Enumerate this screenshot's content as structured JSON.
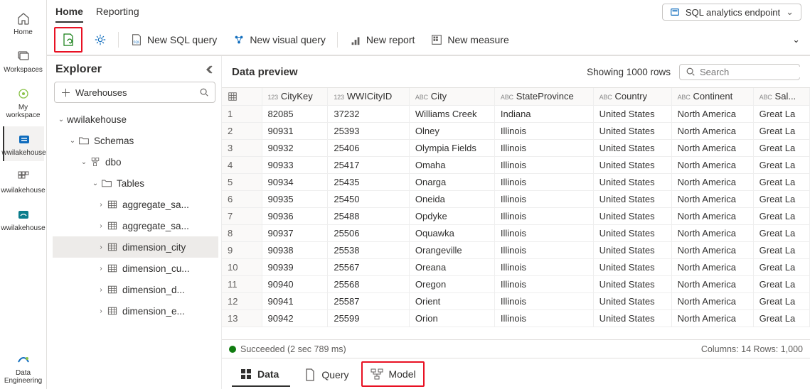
{
  "rail": {
    "items": [
      {
        "label": "Home",
        "icon": "home"
      },
      {
        "label": "Workspaces",
        "icon": "stack"
      },
      {
        "label": "My workspace",
        "icon": "sparkle"
      },
      {
        "label": "wwilakehouse",
        "icon": "lakehouse-blue",
        "active": true
      },
      {
        "label": "wwilakehouse",
        "icon": "grid9"
      },
      {
        "label": "wwilakehouse",
        "icon": "lakehouse-teal"
      }
    ],
    "footer": {
      "label": "Data Engineering",
      "icon": "swoosh"
    }
  },
  "topnav": {
    "items": [
      "Home",
      "Reporting"
    ],
    "active": "Home"
  },
  "endpoint": {
    "label": "SQL analytics endpoint"
  },
  "toolbar": {
    "refresh": "",
    "settings": "",
    "new_sql": "New SQL query",
    "new_visual": "New visual query",
    "new_report": "New report",
    "new_measure": "New measure"
  },
  "explorer": {
    "title": "Explorer",
    "warehouses_label": "Warehouses",
    "root": "wwilakehouse",
    "schemas_label": "Schemas",
    "dbo_label": "dbo",
    "tables_label": "Tables",
    "tables": [
      {
        "name": "aggregate_sa..."
      },
      {
        "name": "aggregate_sa..."
      },
      {
        "name": "dimension_city",
        "selected": true
      },
      {
        "name": "dimension_cu..."
      },
      {
        "name": "dimension_d..."
      },
      {
        "name": "dimension_e..."
      }
    ]
  },
  "preview": {
    "title": "Data preview",
    "showing_label": "Showing 1000 rows",
    "search_placeholder": "Search",
    "columns": [
      {
        "type": "123",
        "name": "CityKey"
      },
      {
        "type": "123",
        "name": "WWICityID"
      },
      {
        "type": "ABC",
        "name": "City"
      },
      {
        "type": "ABC",
        "name": "StateProvince"
      },
      {
        "type": "ABC",
        "name": "Country"
      },
      {
        "type": "ABC",
        "name": "Continent"
      },
      {
        "type": "ABC",
        "name": "Sal..."
      }
    ],
    "rows": [
      [
        "82085",
        "37232",
        "Williams Creek",
        "Indiana",
        "United States",
        "North America",
        "Great La"
      ],
      [
        "90931",
        "25393",
        "Olney",
        "Illinois",
        "United States",
        "North America",
        "Great La"
      ],
      [
        "90932",
        "25406",
        "Olympia Fields",
        "Illinois",
        "United States",
        "North America",
        "Great La"
      ],
      [
        "90933",
        "25417",
        "Omaha",
        "Illinois",
        "United States",
        "North America",
        "Great La"
      ],
      [
        "90934",
        "25435",
        "Onarga",
        "Illinois",
        "United States",
        "North America",
        "Great La"
      ],
      [
        "90935",
        "25450",
        "Oneida",
        "Illinois",
        "United States",
        "North America",
        "Great La"
      ],
      [
        "90936",
        "25488",
        "Opdyke",
        "Illinois",
        "United States",
        "North America",
        "Great La"
      ],
      [
        "90937",
        "25506",
        "Oquawka",
        "Illinois",
        "United States",
        "North America",
        "Great La"
      ],
      [
        "90938",
        "25538",
        "Orangeville",
        "Illinois",
        "United States",
        "North America",
        "Great La"
      ],
      [
        "90939",
        "25567",
        "Oreana",
        "Illinois",
        "United States",
        "North America",
        "Great La"
      ],
      [
        "90940",
        "25568",
        "Oregon",
        "Illinois",
        "United States",
        "North America",
        "Great La"
      ],
      [
        "90941",
        "25587",
        "Orient",
        "Illinois",
        "United States",
        "North America",
        "Great La"
      ],
      [
        "90942",
        "25599",
        "Orion",
        "Illinois",
        "United States",
        "North America",
        "Great La"
      ]
    ],
    "status_text": "Succeeded (2 sec 789 ms)",
    "footer_text": "Columns: 14  Rows: 1,000"
  },
  "viewtabs": {
    "items": [
      {
        "label": "Data",
        "icon": "grid4"
      },
      {
        "label": "Query",
        "icon": "doc"
      },
      {
        "label": "Model",
        "icon": "model",
        "highlight": true
      }
    ],
    "active": "Data"
  }
}
